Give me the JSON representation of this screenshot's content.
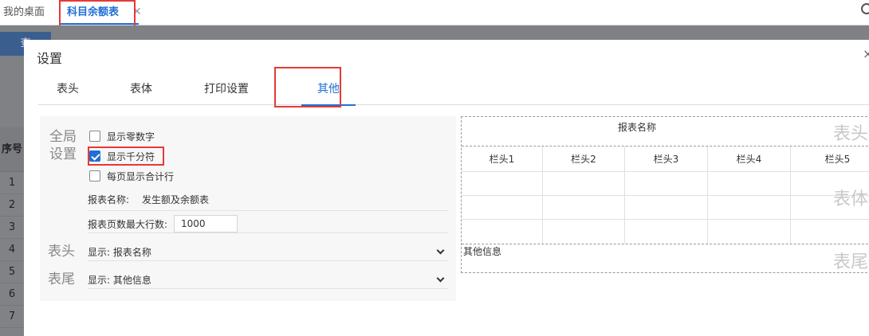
{
  "tabs": {
    "home_label": "我的桌面",
    "active_label": "科目余额表",
    "close_glyph": "✕"
  },
  "background": {
    "query_label": "查",
    "seq_header": "序号",
    "rows": [
      "1",
      "2",
      "3",
      "4",
      "5",
      "6",
      "7"
    ]
  },
  "dialog": {
    "title": "设置",
    "close_glyph": "×",
    "tabs": [
      "表头",
      "表体",
      "打印设置",
      "其他"
    ],
    "active_tab": "其他"
  },
  "settings": {
    "global_label_line1": "全局",
    "global_label_line2": "设置",
    "show_zero": {
      "label": "显示零数字",
      "checked": false
    },
    "show_thousands": {
      "label": "显示千分符",
      "checked": true
    },
    "show_total_each_page": {
      "label": "每页显示合计行",
      "checked": false
    },
    "report_name_label": "报表名称:",
    "report_name_value": "发生额及余额表",
    "max_rows_label": "报表页数最大行数:",
    "max_rows_value": "1000",
    "header_label": "表头",
    "header_display": "显示: 报表名称",
    "footer_label": "表尾",
    "footer_display": "显示: 其他信息"
  },
  "preview": {
    "report_name": "报表名称",
    "wm_header": "表头",
    "wm_body": "表体",
    "wm_footer": "表尾",
    "columns": [
      "栏头1",
      "栏头2",
      "栏头3",
      "栏头4",
      "栏头5"
    ],
    "footer_text": "其他信息"
  },
  "colors": {
    "accent": "#1f6fd6",
    "highlight": "#e53935"
  }
}
